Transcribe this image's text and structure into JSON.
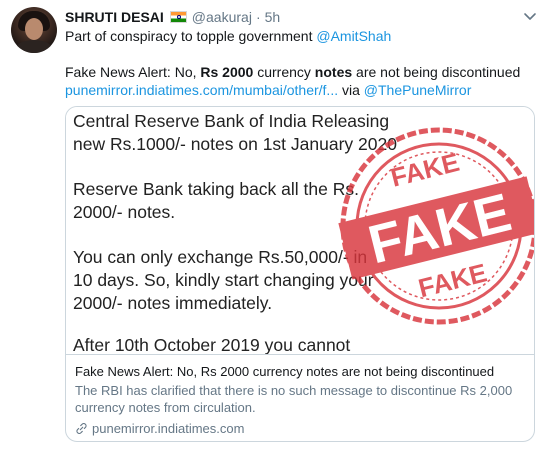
{
  "tweet": {
    "author_name": "SHRUTI DESAI",
    "flag_icon": "india-flag-icon",
    "handle": "@aakuraj",
    "separator": "·",
    "time": "5h",
    "line1_text": "Part of conspiracy to topple government ",
    "line1_mention": "@AmitShah",
    "line2_prefix": "Fake News Alert: No, ",
    "line2_bold1": "Rs 2000",
    "line2_mid": " currency ",
    "line2_bold2": "notes",
    "line2_suffix": " are not being discontinued",
    "line3_link": "punemirror.indiatimes.com/mumbai/other/f...",
    "line3_via": " via ",
    "line3_mention": "@ThePuneMirror"
  },
  "card": {
    "image_lines": [
      "Central Reserve Bank of India Releasing",
      "new Rs.1000/- notes on 1st January 2020",
      "Reserve Bank taking back all the Rs.",
      "2000/- notes.",
      "You can only exchange Rs.50,000/- in",
      "10 days. So, kindly start changing your",
      "2000/- notes immediately.",
      "After 10th October 2019 you cannot"
    ],
    "stamp_top": "FAKE",
    "stamp_main": "FAKE",
    "stamp_bottom": "FAKE",
    "title": "Fake News Alert: No, Rs 2000 currency notes are not being discontinued",
    "description": "The RBI has clarified that there is no such message to discontinue Rs 2,000 currency notes from circulation.",
    "domain": "punemirror.indiatimes.com"
  },
  "colors": {
    "link": "#1b95e0",
    "muted": "#657786",
    "stamp": "#d8353c"
  }
}
